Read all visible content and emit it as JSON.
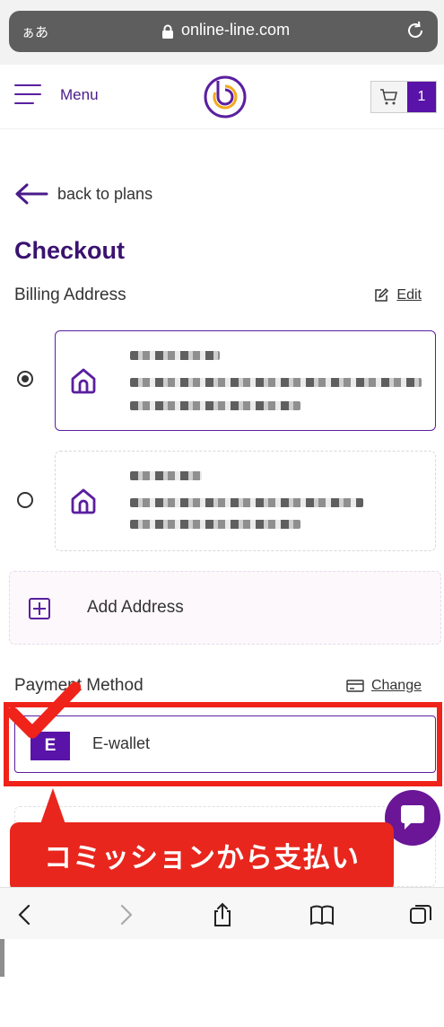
{
  "browser": {
    "aa_label": "ぁあ",
    "url": "online-line.com",
    "icons": [
      "lock-icon",
      "reload-icon",
      "back-icon",
      "forward-icon",
      "share-icon",
      "bookmarks-icon",
      "tabs-icon"
    ]
  },
  "header": {
    "menu_label": "Menu",
    "cart_count": "1"
  },
  "nav": {
    "back_label": "back to plans"
  },
  "page": {
    "title": "Checkout"
  },
  "billing": {
    "title": "Billing Address",
    "edit_label": "Edit",
    "addresses": [
      {
        "selected": true
      },
      {
        "selected": false
      }
    ],
    "add_label": "Add Address"
  },
  "payment": {
    "title": "Payment Method",
    "change_label": "Change",
    "method_initial": "E",
    "method_label": "E-wallet"
  },
  "annotation": {
    "callout_text": "コミッションから支払い"
  },
  "colors": {
    "brand_purple": "#5a13a8",
    "title_purple": "#3a1270",
    "annotation_red": "#e8261d"
  }
}
